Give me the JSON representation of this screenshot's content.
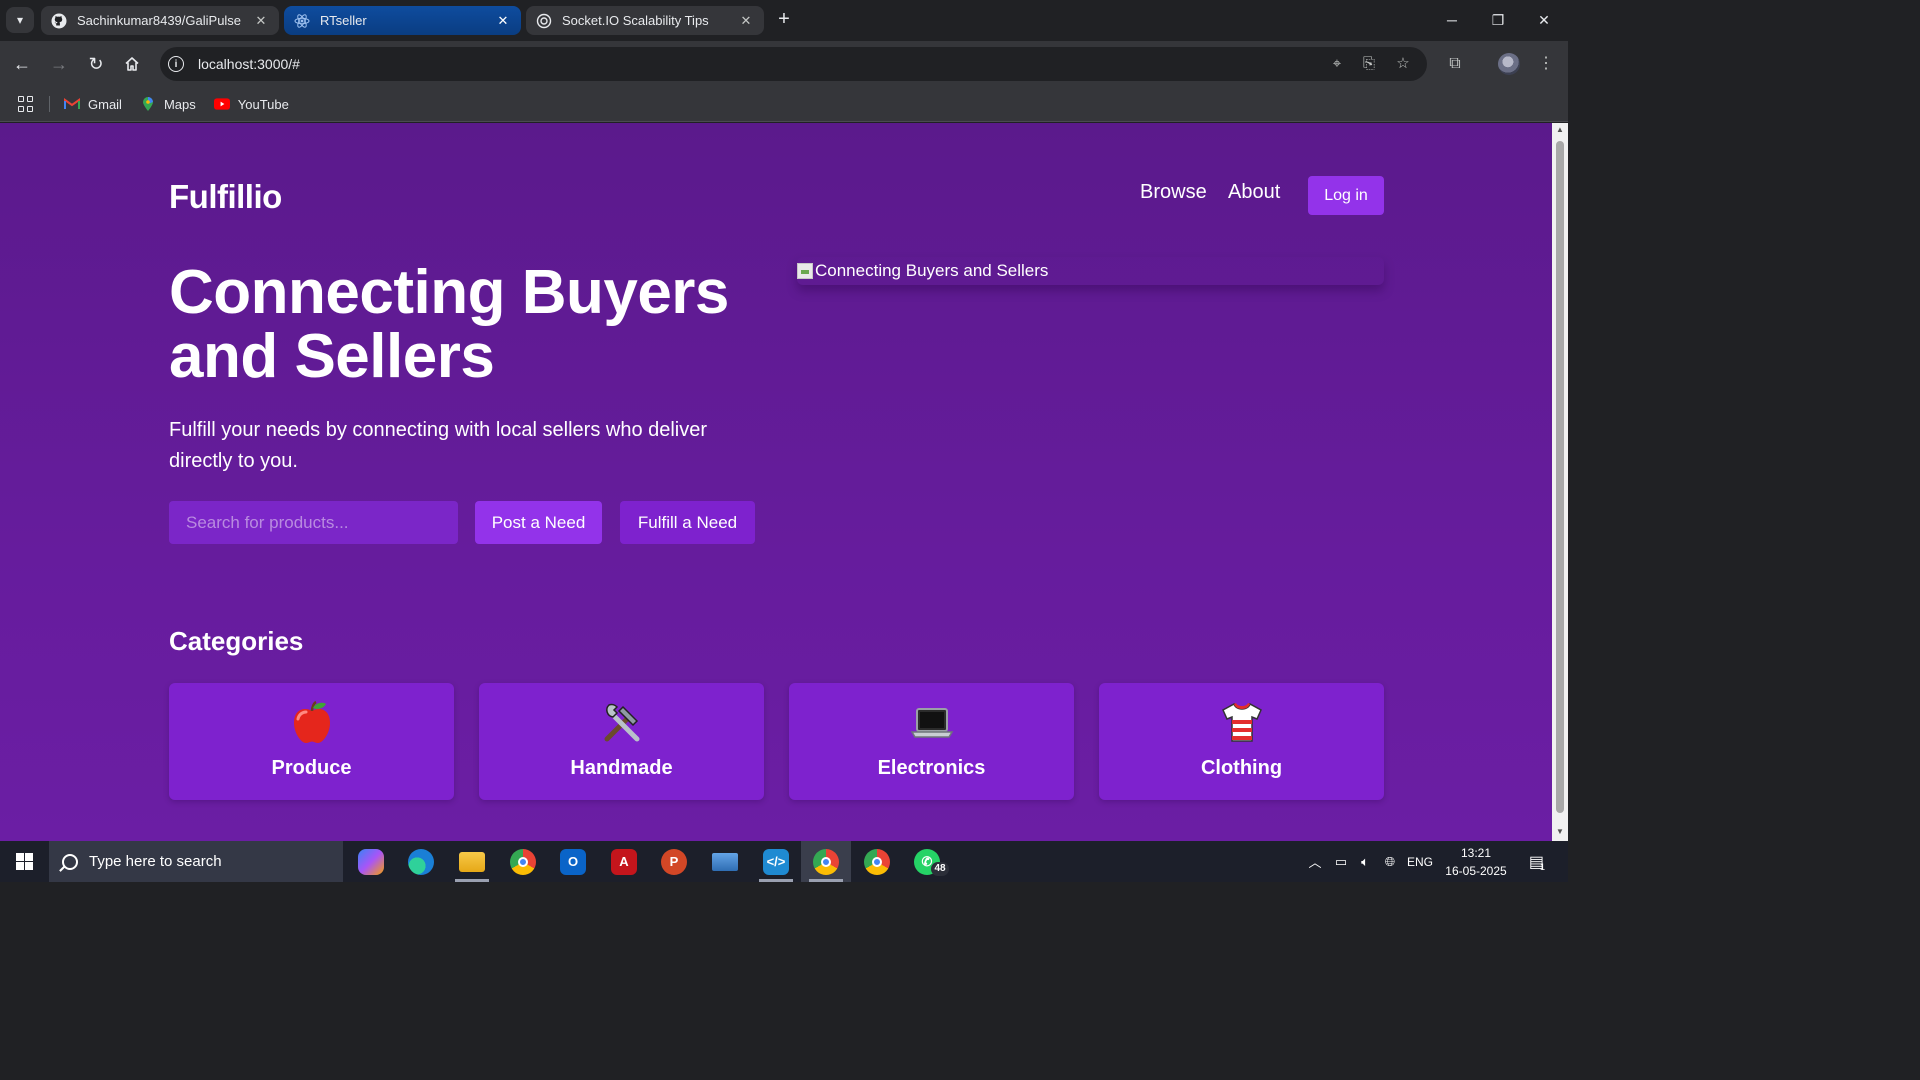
{
  "browser": {
    "tabs": [
      {
        "title": "Sachinkumar8439/GaliPulse",
        "icon": "github-icon",
        "active": false
      },
      {
        "title": "RTseller",
        "icon": "react-icon",
        "active": true
      },
      {
        "title": "Socket.IO Scalability Tips",
        "icon": "openai-icon",
        "active": false
      }
    ],
    "url": "localhost:3000/#",
    "bookmarks": [
      {
        "label": "Gmail",
        "icon": "gmail-icon"
      },
      {
        "label": "Maps",
        "icon": "maps-icon"
      },
      {
        "label": "YouTube",
        "icon": "youtube-icon"
      }
    ]
  },
  "site": {
    "brand": "Fulfillio",
    "nav": {
      "browse": "Browse",
      "about": "About",
      "login": "Log in"
    },
    "hero": {
      "title": "Connecting Buyers and Sellers",
      "subtitle": "Fulfill your needs by connecting with local sellers who deliver directly to you.",
      "search_placeholder": "Search for products...",
      "post_button": "Post a Need",
      "fulfill_button": "Fulfill a Need",
      "image_alt": "Connecting Buyers and Sellers"
    },
    "categories_title": "Categories",
    "categories": [
      {
        "label": "Produce",
        "emoji": "🍎"
      },
      {
        "label": "Handmade",
        "emoji": "🛠️"
      },
      {
        "label": "Electronics",
        "emoji": "💻"
      },
      {
        "label": "Clothing",
        "emoji": "👕"
      }
    ]
  },
  "taskbar": {
    "search_placeholder": "Type here to search",
    "whatsapp_badge": "48",
    "language": "ENG",
    "time": "13:21",
    "date": "16-05-2025",
    "notifications": "1"
  },
  "colors": {
    "page_bg": "#661c9d",
    "primary_button": "#9333ea",
    "card_bg": "#7e22ce"
  }
}
